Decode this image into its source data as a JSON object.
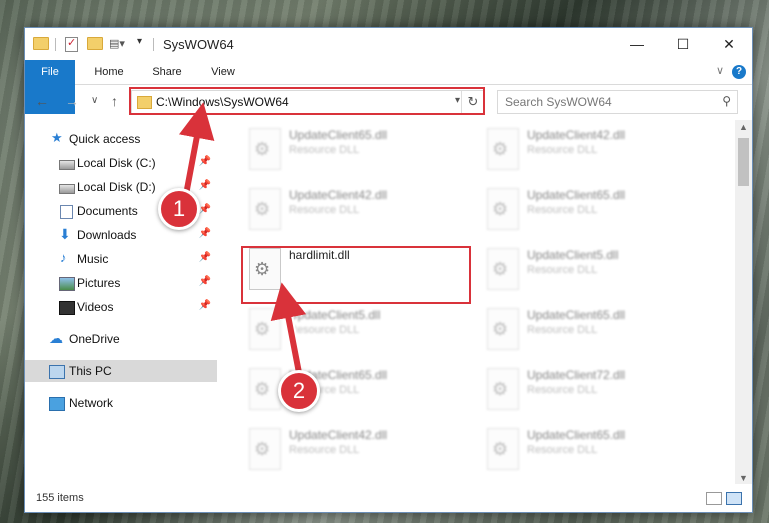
{
  "window": {
    "title": "SysWOW64",
    "controls": {
      "minimize": "—",
      "maximize": "☐",
      "close": "✕"
    }
  },
  "ribbon": {
    "tabs": [
      "File",
      "Home",
      "Share",
      "View"
    ],
    "collapse_glyph": "∨",
    "help_glyph": "?"
  },
  "nav": {
    "back": "←",
    "forward": "→",
    "recent": "∨",
    "up": "↑",
    "address": "C:\\Windows\\SysWOW64",
    "refresh": "↻",
    "search_placeholder": "Search SysWOW64",
    "search_glyph": "⚲"
  },
  "sidebar": {
    "quick_access": "Quick access",
    "items": [
      {
        "label": "Local Disk (C:)",
        "pinned": "📌"
      },
      {
        "label": "Local Disk (D:)",
        "pinned": "📌"
      },
      {
        "label": "Documents",
        "pinned": "📌"
      },
      {
        "label": "Downloads",
        "pinned": "📌"
      },
      {
        "label": "Music",
        "pinned": "📌"
      },
      {
        "label": "Pictures",
        "pinned": "📌"
      },
      {
        "label": "Videos",
        "pinned": "📌"
      }
    ],
    "onedrive": "OneDrive",
    "this_pc": "This PC",
    "network": "Network"
  },
  "files": {
    "col1": [
      {
        "name": "UpdateClient65.dll",
        "type": "Resource DLL"
      },
      {
        "name": "UpdateClient42.dll",
        "type": "Resource DLL"
      },
      {
        "name": "hardlimit.dll",
        "type": ""
      },
      {
        "name": "UpdateClient5.dll",
        "type": "Resource DLL"
      },
      {
        "name": "UpdateClient65.dll",
        "type": "Resource DLL"
      },
      {
        "name": "UpdateClient42.dll",
        "type": "Resource DLL"
      }
    ],
    "col2": [
      {
        "name": "UpdateClient42.dll",
        "type": "Resource DLL"
      },
      {
        "name": "UpdateClient65.dll",
        "type": "Resource DLL"
      },
      {
        "name": "UpdateClient5.dll",
        "type": "Resource DLL"
      },
      {
        "name": "UpdateClient65.dll",
        "type": "Resource DLL"
      },
      {
        "name": "UpdateClient72.dll",
        "type": "Resource DLL"
      },
      {
        "name": "UpdateClient65.dll",
        "type": "Resource DLL"
      }
    ]
  },
  "status": {
    "count": "155 items"
  },
  "annotations": {
    "step1": "1",
    "step2": "2"
  },
  "colors": {
    "accent": "#1979ca",
    "highlight": "#d9323a"
  }
}
